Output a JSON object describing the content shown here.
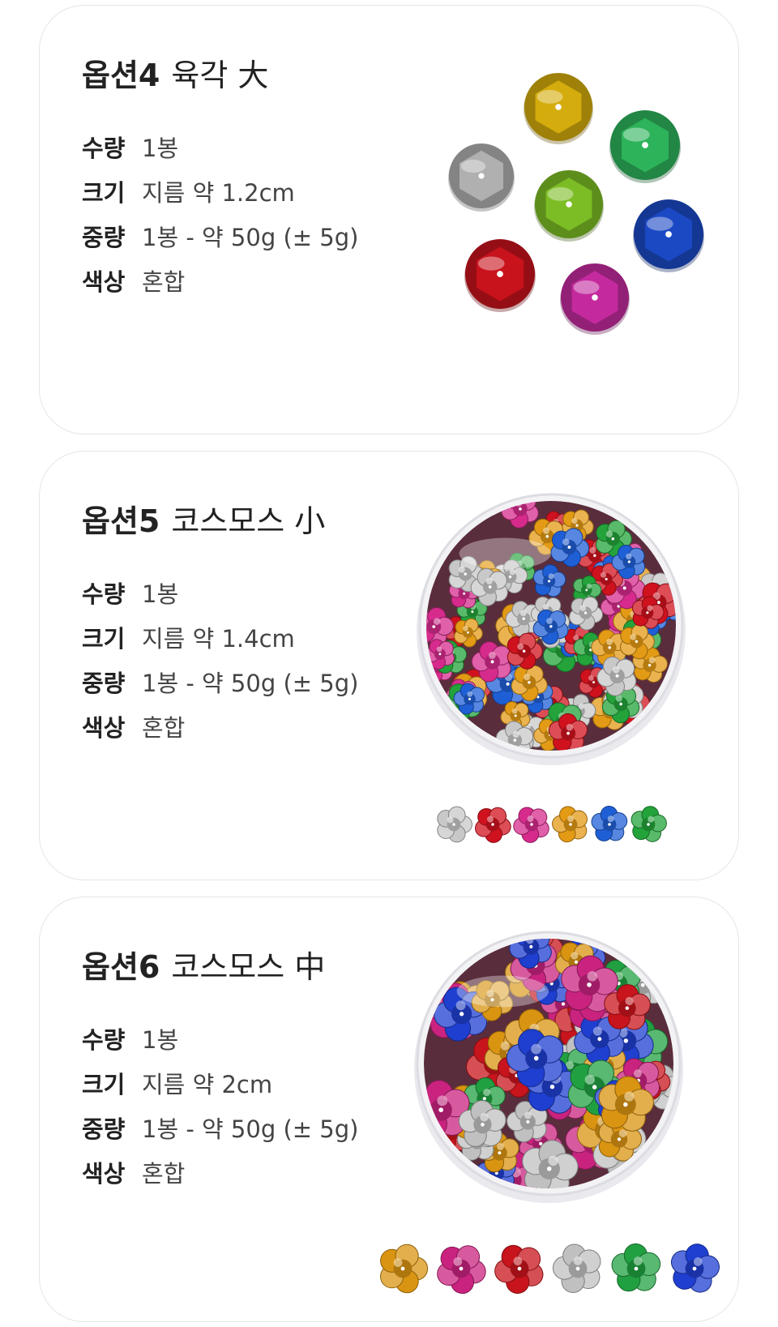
{
  "options": [
    {
      "number": "옵션4",
      "name": "육각 大",
      "specs": [
        {
          "label": "수량",
          "value": "1봉"
        },
        {
          "label": "크기",
          "value": "지름 약 1.2cm"
        },
        {
          "label": "중량",
          "value": "1봉 - 약 50g (± 5g)"
        },
        {
          "label": "색상",
          "value": "혼합"
        }
      ],
      "image": {
        "kind": "hexagonal-cup-sequins",
        "colors": [
          "#d4ac0d",
          "#b0b0b0",
          "#2db35a",
          "#7cbd25",
          "#1b49c4",
          "#c8121c",
          "#c42a9e"
        ]
      }
    },
    {
      "number": "옵션5",
      "name": "코스모스 小",
      "specs": [
        {
          "label": "수량",
          "value": "1봉"
        },
        {
          "label": "크기",
          "value": "지름 약 1.4cm"
        },
        {
          "label": "중량",
          "value": "1봉 - 약 50g (± 5g)"
        },
        {
          "label": "색상",
          "value": "혼합"
        }
      ],
      "image": {
        "kind": "cosmos-flower-sequins-jar",
        "swatches": [
          "#c8c8c8",
          "#d0121e",
          "#d62b8c",
          "#e39a14",
          "#1f5fd6",
          "#23a33a"
        ]
      }
    },
    {
      "number": "옵션6",
      "name": "코스모스 中",
      "specs": [
        {
          "label": "수량",
          "value": "1봉"
        },
        {
          "label": "크기",
          "value": "지름 약 2cm"
        },
        {
          "label": "중량",
          "value": "1봉 - 약 50g (± 5g)"
        },
        {
          "label": "색상",
          "value": "혼합"
        }
      ],
      "image": {
        "kind": "cosmos-flower-sequins-jar",
        "swatches": [
          "#d99411",
          "#c9237f",
          "#c8141c",
          "#c0c0c0",
          "#21a041",
          "#1f3fd0"
        ]
      }
    }
  ]
}
